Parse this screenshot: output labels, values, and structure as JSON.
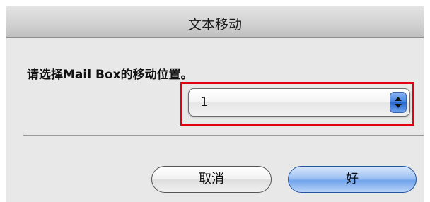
{
  "dialog": {
    "title": "文本移动",
    "prompt": "请选择Mail Box的移动位置。",
    "mailbox_select": {
      "selected_value": "1"
    },
    "buttons": {
      "cancel_label": "取消",
      "ok_label": "好"
    }
  },
  "colors": {
    "highlight_border": "#e0000f",
    "default_button": "#6fa3ec"
  },
  "icons": {
    "select_arrows": "up-down-arrows-icon"
  }
}
